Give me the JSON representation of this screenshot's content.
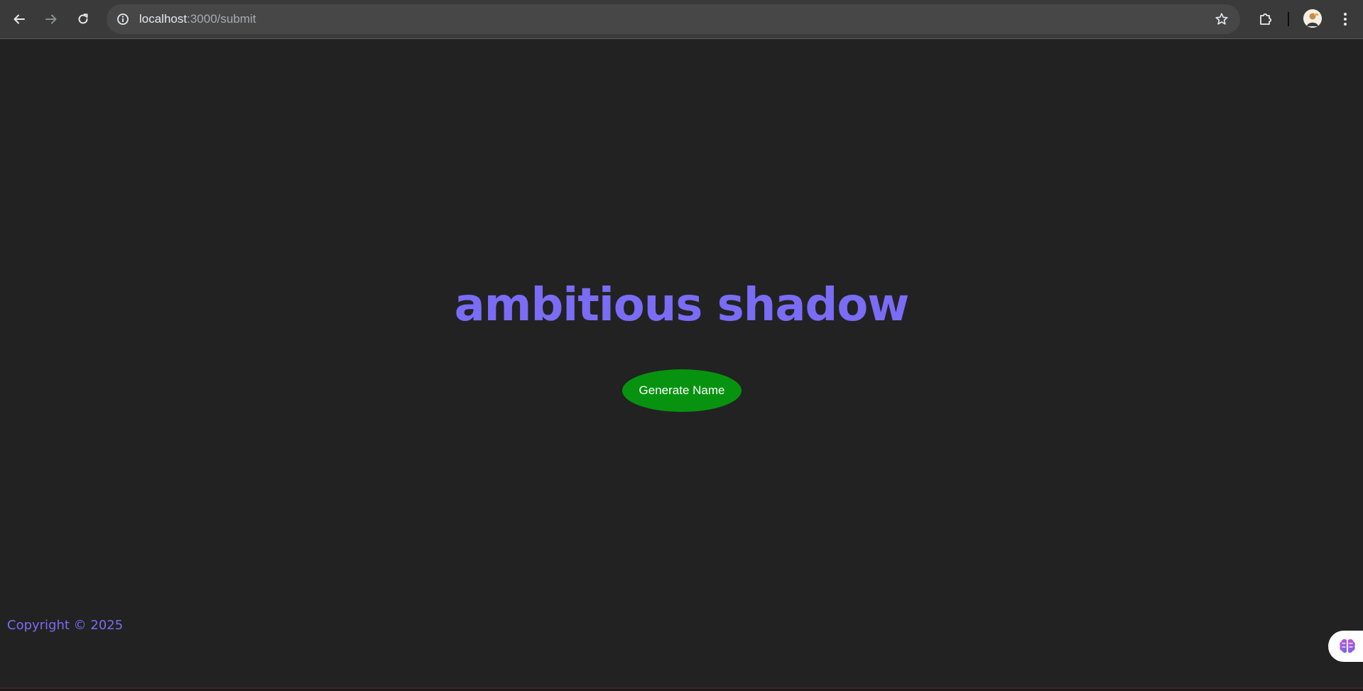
{
  "browser": {
    "url_host": "localhost",
    "url_path": ":3000/submit",
    "icons": {
      "back": "arrow-left-icon",
      "forward": "arrow-right-icon",
      "reload": "reload-icon",
      "site_info": "info-icon",
      "bookmark": "star-icon",
      "extensions": "puzzle-icon",
      "profile": "avatar",
      "menu": "kebab-menu-icon"
    }
  },
  "main": {
    "generated_name": "ambitious shadow",
    "generate_button_label": "Generate Name"
  },
  "footer": {
    "copyright": "Copyright © 2025"
  },
  "floating_extension": {
    "icon": "brain-icon"
  },
  "colors": {
    "background": "#222222",
    "accent_text": "#7a6cf4",
    "button_bg": "#07930f",
    "button_text": "#ffffff",
    "toolbar_bg": "#3a3a3a",
    "omnibox_bg": "#474747"
  }
}
